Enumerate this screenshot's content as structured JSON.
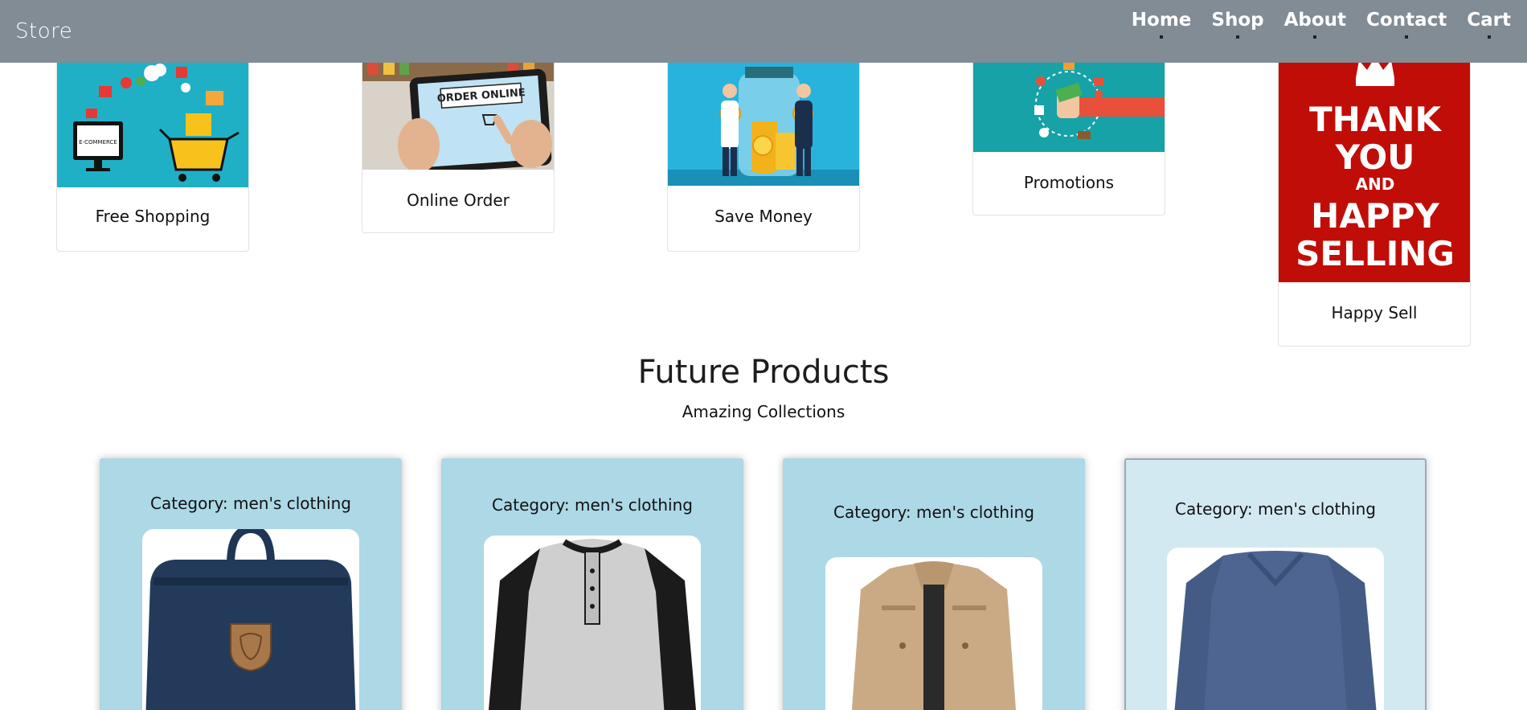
{
  "navbar": {
    "brand": "Store",
    "links": [
      "Home",
      "Shop",
      "About",
      "Contact",
      "Cart"
    ]
  },
  "features": [
    {
      "caption": "Free Shopping",
      "image": "ecommerce-illustration"
    },
    {
      "caption": "Online Order",
      "image": "tablet-order-online-photo",
      "image_text": "ORDER ONLINE"
    },
    {
      "caption": "Save Money",
      "image": "coin-jar-illustration"
    },
    {
      "caption": "Promotions",
      "image": "promotion-hand-illustration"
    },
    {
      "caption": "Happy Sell",
      "image": "thank-you-poster",
      "poster_lines": [
        "THANK",
        "YOU",
        "AND",
        "HAPPY",
        "SELLING"
      ]
    }
  ],
  "section": {
    "title": "Future Products",
    "subtitle": "Amazing Collections"
  },
  "products": [
    {
      "category": "Category: men's clothing",
      "image": "navy-backpack-photo"
    },
    {
      "category": "Category: men's clothing",
      "image": "raglan-henley-shirt-photo"
    },
    {
      "category": "Category: men's clothing",
      "image": "khaki-jacket-photo"
    },
    {
      "category": "Category: men's clothing",
      "image": "blue-long-sleeve-tee-photo"
    }
  ],
  "colors": {
    "navbar": "#818c95",
    "product_card": "#add8e6",
    "poster_red": "#c10d08"
  }
}
